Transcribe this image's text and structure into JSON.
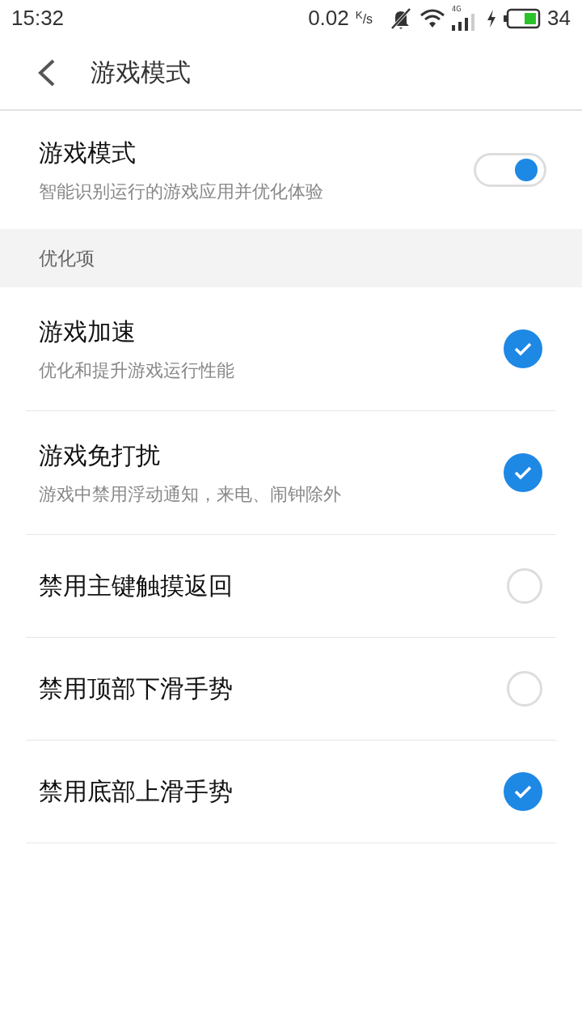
{
  "status_bar": {
    "time": "15:32",
    "speed": "0.02",
    "speed_unit": "$^{K}$/s",
    "network": "4G",
    "battery": "34"
  },
  "header": {
    "title": "游戏模式"
  },
  "main": {
    "title": "游戏模式",
    "subtitle": "智能识别运行的游戏应用并优化体验",
    "on": true
  },
  "section": {
    "title": "优化项"
  },
  "items": [
    {
      "title": "游戏加速",
      "subtitle": "优化和提升游戏运行性能",
      "checked": true
    },
    {
      "title": "游戏免打扰",
      "subtitle": "游戏中禁用浮动通知，来电、闹钟除外",
      "checked": true
    },
    {
      "title": "禁用主键触摸返回",
      "checked": false
    },
    {
      "title": "禁用顶部下滑手势",
      "checked": false
    },
    {
      "title": "禁用底部上滑手势",
      "checked": true
    }
  ]
}
